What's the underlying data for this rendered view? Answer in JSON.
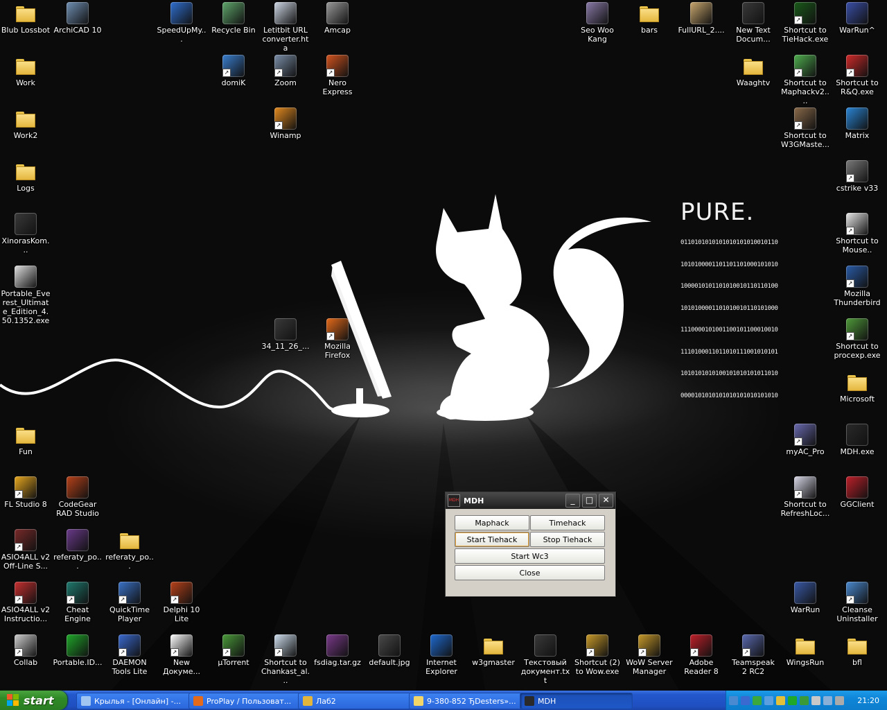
{
  "wallpaper": {
    "brand_title": "PURE.",
    "binary_lines": [
      "0110101010101010101010010110",
      "1010100001101101101000101010",
      "1000010101101010010110110100",
      "1010100001101010010110101000",
      "1110000101001100101100010010",
      "1110100011011010111001010101",
      "1010101010100101010101011010",
      "0000101010101010101010101010"
    ]
  },
  "desktop_icons": [
    {
      "label": "Blub Lossbot",
      "type": "folder",
      "color": "#e3b53a",
      "sc": false
    },
    {
      "label": "ArchiCAD 10",
      "type": "app",
      "color": "#6f8fb3",
      "sc": false
    },
    {
      "label": "SpeedUpMy...",
      "type": "app",
      "color": "#2f6fd0",
      "sc": false
    },
    {
      "label": "Recycle Bin",
      "type": "app",
      "color": "#5fa66b",
      "sc": false
    },
    {
      "label": "Letitbit URL converter.hta",
      "type": "app",
      "color": "#cfd8e6",
      "sc": false
    },
    {
      "label": "Amcap",
      "type": "app",
      "color": "#9a9a9a",
      "sc": false
    },
    {
      "label": "Seo Woo Kang",
      "type": "app",
      "color": "#8a7aa8",
      "sc": false
    },
    {
      "label": "bars",
      "type": "folder",
      "color": "#e3b53a",
      "sc": false
    },
    {
      "label": "FullURL_2....",
      "type": "app",
      "color": "#c9a76e",
      "sc": false
    },
    {
      "label": "New Text Docum...",
      "type": "app",
      "color": "#3a3a3a",
      "sc": false
    },
    {
      "label": "Shortcut to TieHack.exe",
      "type": "app",
      "color": "#1a5a1a",
      "sc": true
    },
    {
      "label": "WarRun^",
      "type": "app",
      "color": "#3a4fa8",
      "sc": false
    },
    {
      "label": "Work",
      "type": "folder",
      "color": "#e3b53a",
      "sc": false
    },
    {
      "label": "domiK",
      "type": "app",
      "color": "#3a7fd0",
      "sc": true
    },
    {
      "label": "Zoom",
      "type": "app",
      "color": "#7a8ea8",
      "sc": true
    },
    {
      "label": "Nero Express",
      "type": "app",
      "color": "#d2541f",
      "sc": true
    },
    {
      "label": "Waaghtv",
      "type": "folder",
      "color": "#e3b53a",
      "sc": false
    },
    {
      "label": "Shortcut to Maphackv2....",
      "type": "app",
      "color": "#4fae4f",
      "sc": true
    },
    {
      "label": "Shortcut to R&Q.exe",
      "type": "app",
      "color": "#d02a2a",
      "sc": true
    },
    {
      "label": "Work2",
      "type": "folder",
      "color": "#e3b53a",
      "sc": false
    },
    {
      "label": "Winamp",
      "type": "app",
      "color": "#e38a1f",
      "sc": true
    },
    {
      "label": "Shortcut to W3GMaste...",
      "type": "app",
      "color": "#8a6a4a",
      "sc": true
    },
    {
      "label": "Matrix",
      "type": "app",
      "color": "#2a86d6",
      "sc": false
    },
    {
      "label": "Logs",
      "type": "folder",
      "color": "#e3b53a",
      "sc": false
    },
    {
      "label": "cstrike v33",
      "type": "app",
      "color": "#7a7a7a",
      "sc": true
    },
    {
      "label": "XinorasKom...",
      "type": "app",
      "color": "#3a3a3a",
      "sc": false
    },
    {
      "label": "Shortcut to Mouse..",
      "type": "app",
      "color": "#e8e8e8",
      "sc": true
    },
    {
      "label": "Portable_Everest_Ultimate_Edition_4.50.1352.exe",
      "type": "app",
      "color": "#e0e0e0",
      "sc": false
    },
    {
      "label": "Mozilla Thunderbird",
      "type": "app",
      "color": "#2a5ca8",
      "sc": true
    },
    {
      "label": "34_11_26_...",
      "type": "app",
      "color": "#3a3a3a",
      "sc": false
    },
    {
      "label": "Mozilla Firefox",
      "type": "app",
      "color": "#e56a1a",
      "sc": true
    },
    {
      "label": "Shortcut to procexp.exe",
      "type": "app",
      "color": "#4f9a3a",
      "sc": true
    },
    {
      "label": "Microsoft",
      "type": "folder",
      "color": "#e3b53a",
      "sc": false
    },
    {
      "label": "Fun",
      "type": "folder",
      "color": "#e3b53a",
      "sc": false
    },
    {
      "label": "myAC_Pro",
      "type": "app",
      "color": "#6a6ab0",
      "sc": true
    },
    {
      "label": "MDH.exe",
      "type": "app",
      "color": "#2a2a2a",
      "sc": false
    },
    {
      "label": "FL Studio 8",
      "type": "app",
      "color": "#e8a81f",
      "sc": true
    },
    {
      "label": "CodeGear RAD Studio",
      "type": "app",
      "color": "#b8421a",
      "sc": false
    },
    {
      "label": "Shortcut to RefreshLoc...",
      "type": "app",
      "color": "#d8d8e8",
      "sc": true
    },
    {
      "label": "GGClient",
      "type": "app",
      "color": "#c0202a",
      "sc": false
    },
    {
      "label": "ASIO4ALL v2 Off-Line S...",
      "type": "app",
      "color": "#7a2a2a",
      "sc": true
    },
    {
      "label": "referaty_po...",
      "type": "app",
      "color": "#6a3a8a",
      "sc": false
    },
    {
      "label": "referaty_po...",
      "type": "folder",
      "color": "#e3b53a",
      "sc": false
    },
    {
      "label": "ASIO4ALL v2 Instructio...",
      "type": "app",
      "color": "#c83030",
      "sc": true
    },
    {
      "label": "Cheat Engine",
      "type": "app",
      "color": "#1f7a6f",
      "sc": true
    },
    {
      "label": "QuickTime Player",
      "type": "app",
      "color": "#3a72c8",
      "sc": true
    },
    {
      "label": "Delphi 10 Lite",
      "type": "app",
      "color": "#b8421a",
      "sc": true
    },
    {
      "label": "WarRun",
      "type": "app",
      "color": "#3a5aa8",
      "sc": false
    },
    {
      "label": "Cleanse Uninstaller",
      "type": "app",
      "color": "#4a8ad0",
      "sc": true
    },
    {
      "label": "Collab",
      "type": "app",
      "color": "#cfcfcf",
      "sc": true
    },
    {
      "label": "Portable.ID...",
      "type": "app",
      "color": "#1fa82a",
      "sc": false
    },
    {
      "label": "DAEMON Tools Lite",
      "type": "app",
      "color": "#3a6ad0",
      "sc": true
    },
    {
      "label": "New Докуме...",
      "type": "app",
      "color": "#ffffff",
      "sc": true
    },
    {
      "label": "µTorrent",
      "type": "app",
      "color": "#4a9a3a",
      "sc": true
    },
    {
      "label": "Shortcut to Chankast_al...",
      "type": "app",
      "color": "#cfdfef",
      "sc": true
    },
    {
      "label": "fsdiag.tar.gz",
      "type": "app",
      "color": "#7a3a8a",
      "sc": false
    },
    {
      "label": "default.jpg",
      "type": "app",
      "color": "#4a4a4a",
      "sc": false
    },
    {
      "label": "Internet Explorer",
      "type": "app",
      "color": "#1f6ad0",
      "sc": false
    },
    {
      "label": "w3gmaster",
      "type": "folder",
      "color": "#e3b53a",
      "sc": false
    },
    {
      "label": "Текстовый документ.txt",
      "type": "app",
      "color": "#3a3a3a",
      "sc": false
    },
    {
      "label": "Shortcut (2) to Wow.exe",
      "type": "app",
      "color": "#c89a2a",
      "sc": true
    },
    {
      "label": "WoW Server Manager",
      "type": "app",
      "color": "#c89a2a",
      "sc": true
    },
    {
      "label": "Adobe Reader 8",
      "type": "app",
      "color": "#c0202a",
      "sc": true
    },
    {
      "label": "Teamspeak 2 RC2",
      "type": "app",
      "color": "#5a6ab0",
      "sc": true
    },
    {
      "label": "WingsRun",
      "type": "folder",
      "color": "#e3b53a",
      "sc": false
    },
    {
      "label": "bfl",
      "type": "folder",
      "color": "#e3b53a",
      "sc": false
    }
  ],
  "window": {
    "title": "MDH",
    "buttons": {
      "maphack": "Maphack",
      "timehack": "Timehack",
      "start_tiehack": "Start Tiehack",
      "stop_tiehack": "Stop Tiehack",
      "start_wc3": "Start Wc3",
      "close": "Close"
    },
    "controls": {
      "minimize": "_",
      "maximize": "□",
      "close": "✕"
    }
  },
  "taskbar": {
    "start_label": "start",
    "tasks": [
      {
        "label": "Крылья - [Онлайн] -...",
        "color": "#9fc5f0"
      },
      {
        "label": "ProPlay / Пользоват...",
        "color": "#e56a1a"
      },
      {
        "label": "Лаб2",
        "color": "#e3b53a"
      },
      {
        "label": "9-380-852 ЂDesters»...",
        "color": "#f2d66a"
      },
      {
        "label": "MDH",
        "color": "#2a2a2a"
      }
    ],
    "tray_icon_colors": [
      "#4a8ad0",
      "#3a6ad0",
      "#3aa83a",
      "#5aa0e0",
      "#e3c03a",
      "#1fa82a",
      "#3a9a3a",
      "#c8c8c8",
      "#8ab0d8",
      "#aaaaaa"
    ],
    "clock": "21:20"
  }
}
